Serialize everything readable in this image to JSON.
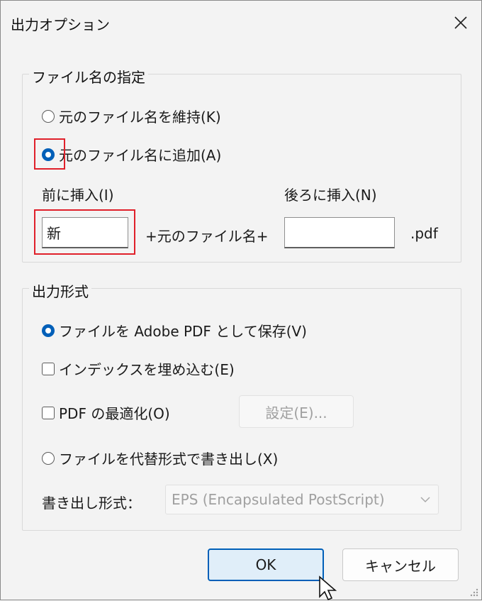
{
  "window": {
    "title": "出力オプション"
  },
  "filename_group": {
    "legend": "ファイル名の指定",
    "keep_label": "元のファイル名を維持(K)",
    "add_label": "元のファイル名に追加(A)",
    "prefix_label": "前に挿入(I)",
    "suffix_label": "後ろに挿入(N)",
    "prefix_value": "新",
    "suffix_value": "",
    "middle_text": "+元のファイル名+",
    "ext_text": ".pdf",
    "selected": "add"
  },
  "format_group": {
    "legend": "出力形式",
    "save_pdf_label": "ファイルを Adobe PDF として保存(V)",
    "embed_index_label": "インデックスを埋め込む(E)",
    "optimize_label": "PDF の最適化(O)",
    "settings_button": "設定(E)...",
    "export_alt_label": "ファイルを代替形式で書き出し(X)",
    "export_format_label": "書き出し形式：",
    "export_format_value": "EPS (Encapsulated PostScript)",
    "selected": "save_pdf",
    "embed_index_checked": false,
    "optimize_checked": false
  },
  "buttons": {
    "ok": "OK",
    "cancel": "キャンセル"
  },
  "colors": {
    "accent": "#005fb8",
    "highlight": "#e0202a"
  }
}
